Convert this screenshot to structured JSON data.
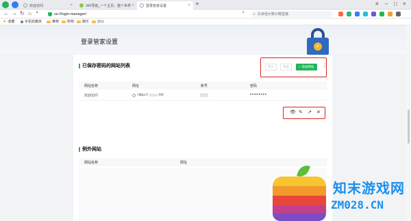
{
  "browser": {
    "tabs": [
      {
        "title": "欢迎访问",
        "active": false
      },
      {
        "title": "360导航_一个主页，整个世界",
        "active": false
      },
      {
        "title": "登录管家设置",
        "active": true
      }
    ],
    "url": "se://login-manager/",
    "search_placeholder": "头目组大臀沙曝直播"
  },
  "bookmarks": [
    {
      "label": "收藏",
      "icon": "star-icon"
    },
    {
      "label": "手机收藏夹",
      "icon": "phone-icon"
    },
    {
      "label": "推荐",
      "icon": "folder-icon"
    },
    {
      "label": "购物",
      "icon": "folder-icon"
    },
    {
      "label": "娱乐",
      "icon": "folder-icon"
    },
    {
      "label": "办公",
      "icon": "folder-icon"
    }
  ],
  "page": {
    "title": "登录管家设置"
  },
  "saved_sites": {
    "title": "已保存密码的网站列表",
    "import_label": "导入",
    "export_label": "导出",
    "add_label": "+ 添加网站",
    "columns": [
      "网站名称",
      "网址",
      "账号",
      "密码"
    ],
    "rows": [
      {
        "name": "欢迎访问",
        "url_prefix": "https://",
        "url_suffix": "64/",
        "password": "••••••••"
      }
    ]
  },
  "excluded_sites": {
    "title": "例外网站",
    "columns": [
      "网站名称",
      "网址"
    ]
  },
  "watermark": {
    "cn": "知末游戏网",
    "en": "ZM028.CN"
  },
  "colors": {
    "accent": "#23b35a",
    "highlight": "#e02020",
    "lock": "#2f69c2"
  }
}
